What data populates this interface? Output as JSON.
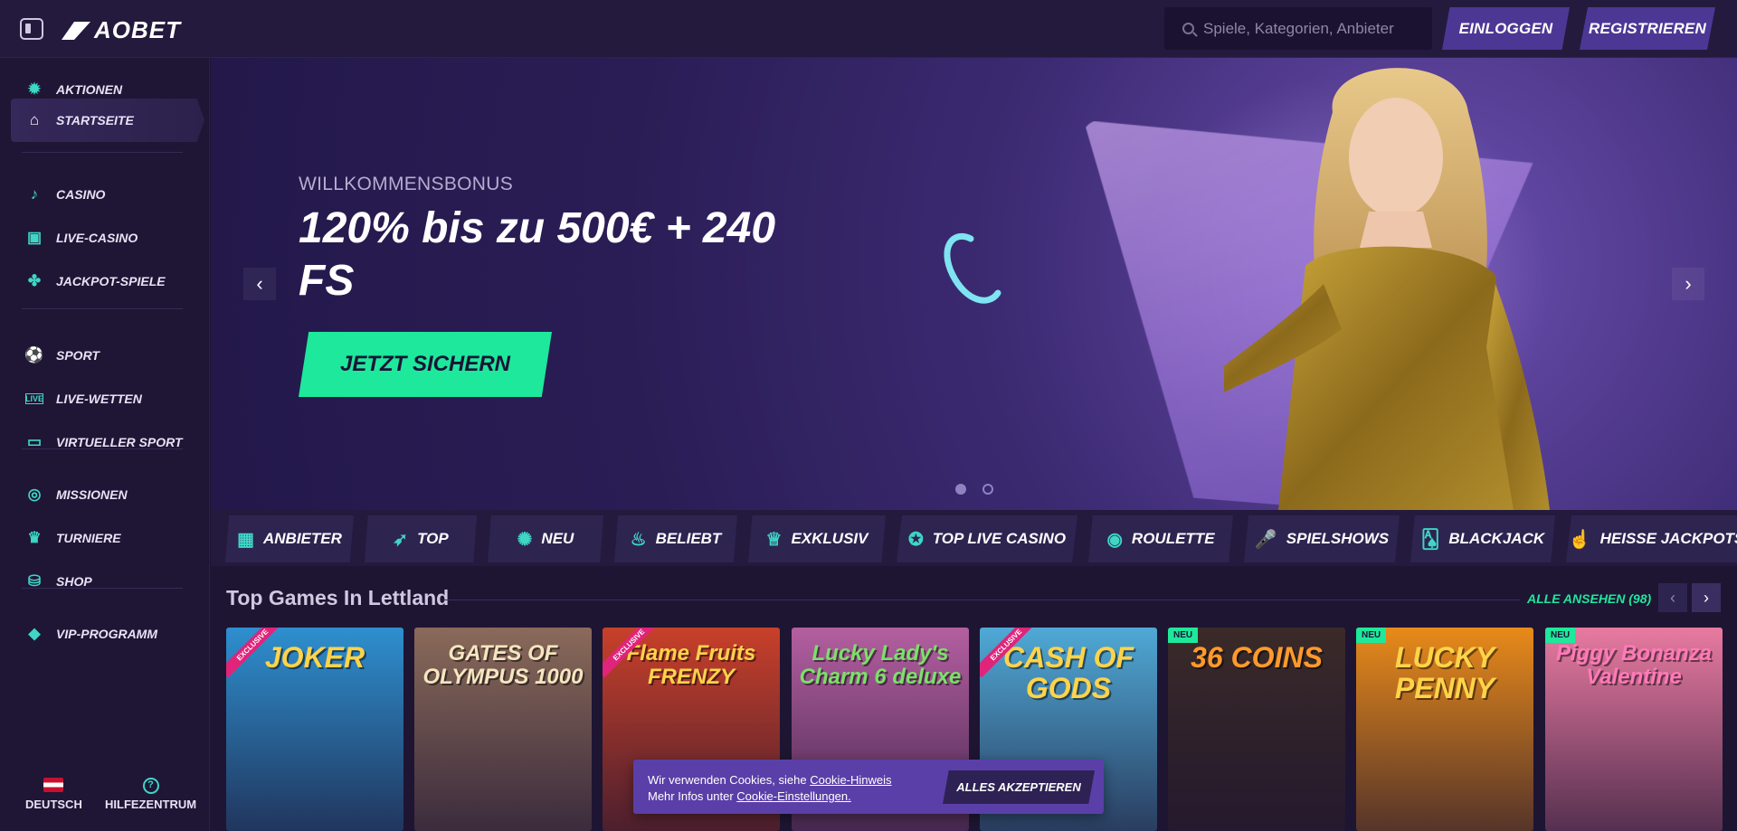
{
  "header": {
    "logo_text": "AOBET",
    "search_placeholder": "Spiele, Kategorien, Anbieter",
    "login_label": "EINLOGGEN",
    "register_label": "REGISTRIEREN"
  },
  "sidebar": {
    "items": [
      {
        "label": "AKTIONEN",
        "icon": "gift-icon"
      },
      {
        "label": "STARTSEITE",
        "icon": "home-icon"
      },
      {
        "label": "CASINO",
        "icon": "cherries-icon"
      },
      {
        "label": "LIVE-CASINO",
        "icon": "live-cards-icon"
      },
      {
        "label": "JACKPOT-SPIELE",
        "icon": "clover-icon"
      },
      {
        "label": "SPORT",
        "icon": "soccer-icon"
      },
      {
        "label": "LIVE-WETTEN",
        "icon": "live-badge-icon"
      },
      {
        "label": "VIRTUELLER SPORT",
        "icon": "screen-icon"
      },
      {
        "label": "MISSIONEN",
        "icon": "medal-icon"
      },
      {
        "label": "TURNIERE",
        "icon": "trophy-icon"
      },
      {
        "label": "SHOP",
        "icon": "basket-icon"
      },
      {
        "label": "VIP-PROGRAMM",
        "icon": "diamond-icon"
      }
    ],
    "language_label": "DEUTSCH",
    "help_label": "HILFEZENTRUM"
  },
  "hero": {
    "subtitle": "WILLKOMMENSBONUS",
    "title": "120% bis zu 500€ + 240 FS",
    "cta_label": "JETZT SICHERN",
    "slide_count": 2,
    "active_slide": 1
  },
  "tabs": [
    {
      "label": "ANBIETER",
      "icon": "grid-icon"
    },
    {
      "label": "TOP",
      "icon": "rocket-icon"
    },
    {
      "label": "NEU",
      "icon": "new-badge-icon"
    },
    {
      "label": "BELIEBT",
      "icon": "flame-icon"
    },
    {
      "label": "EXKLUSIV",
      "icon": "crown-icon"
    },
    {
      "label": "TOP LIVE CASINO",
      "icon": "star-circle-icon"
    },
    {
      "label": "ROULETTE",
      "icon": "roulette-icon"
    },
    {
      "label": "SPIELSHOWS",
      "icon": "microphone-icon"
    },
    {
      "label": "BLACKJACK",
      "icon": "cards-icon"
    },
    {
      "label": "HEISSE JACKPOTS",
      "icon": "fire-hand-icon"
    }
  ],
  "games_section": {
    "title": "Top Games In Lettland",
    "see_all_label": "ALLE ANSEHEN (98)",
    "games": [
      {
        "title": "JOKER",
        "badge": "EXCLUSIVE",
        "color": "#2e8fcf"
      },
      {
        "title": "GATES OF OLYMPUS 1000",
        "badge": "",
        "color": "#8a6a5a"
      },
      {
        "title": "Flame Fruits FRENZY",
        "badge": "EXCLUSIVE",
        "color": "#c8402a"
      },
      {
        "title": "Lucky Lady's Charm 6 deluxe",
        "badge": "",
        "color": "#b45fa0"
      },
      {
        "title": "CASH OF GODS",
        "badge": "EXCLUSIVE",
        "color": "#4fa9d6"
      },
      {
        "title": "36 COINS",
        "badge": "NEU",
        "color": "#3a2a28"
      },
      {
        "title": "LUCKY PENNY",
        "badge": "NEU",
        "color": "#e88a1a"
      },
      {
        "title": "Piggy Bonanza Valentine",
        "badge": "NEU",
        "color": "#e87aa0"
      }
    ]
  },
  "cookie": {
    "text_1": "Wir verwenden Cookies, siehe ",
    "link_1": "Cookie-Hinweis",
    "text_2": "Mehr Infos unter ",
    "link_2": "Cookie-Einstellungen.",
    "accept_label": "ALLES AKZEPTIEREN"
  },
  "colors": {
    "accent_green": "#1ee89b",
    "accent_teal": "#3fd6c6",
    "button_purple": "#4d3794",
    "background": "#1e1533"
  }
}
